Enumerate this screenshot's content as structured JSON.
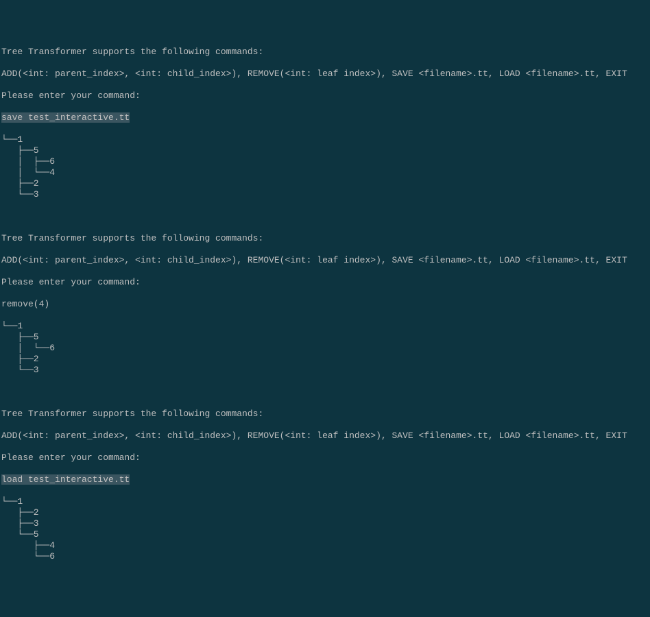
{
  "block1": {
    "header": "Tree Transformer supports the following commands:",
    "commands": "ADD(<int: parent_index>, <int: child_index>), REMOVE(<int: leaf index>), SAVE <filename>.tt, LOAD <filename>.tt, EXIT",
    "prompt": "Please enter your command:",
    "input": "save test_interactive.tt",
    "tree": "└──1\n   ├──5\n   │  ├──6\n   │  └──4\n   ├──2\n   └──3"
  },
  "block2": {
    "header": "Tree Transformer supports the following commands:",
    "commands": "ADD(<int: parent_index>, <int: child_index>), REMOVE(<int: leaf index>), SAVE <filename>.tt, LOAD <filename>.tt, EXIT",
    "prompt": "Please enter your command:",
    "input": "remove(4)",
    "tree": "└──1\n   ├──5\n   │  └──6\n   ├──2\n   └──3"
  },
  "block3": {
    "header": "Tree Transformer supports the following commands:",
    "commands": "ADD(<int: parent_index>, <int: child_index>), REMOVE(<int: leaf index>), SAVE <filename>.tt, LOAD <filename>.tt, EXIT",
    "prompt": "Please enter your command:",
    "input": "load test_interactive.tt",
    "tree": "└──1\n   ├──2\n   ├──3\n   └──5\n      ├──4\n      └──6"
  }
}
